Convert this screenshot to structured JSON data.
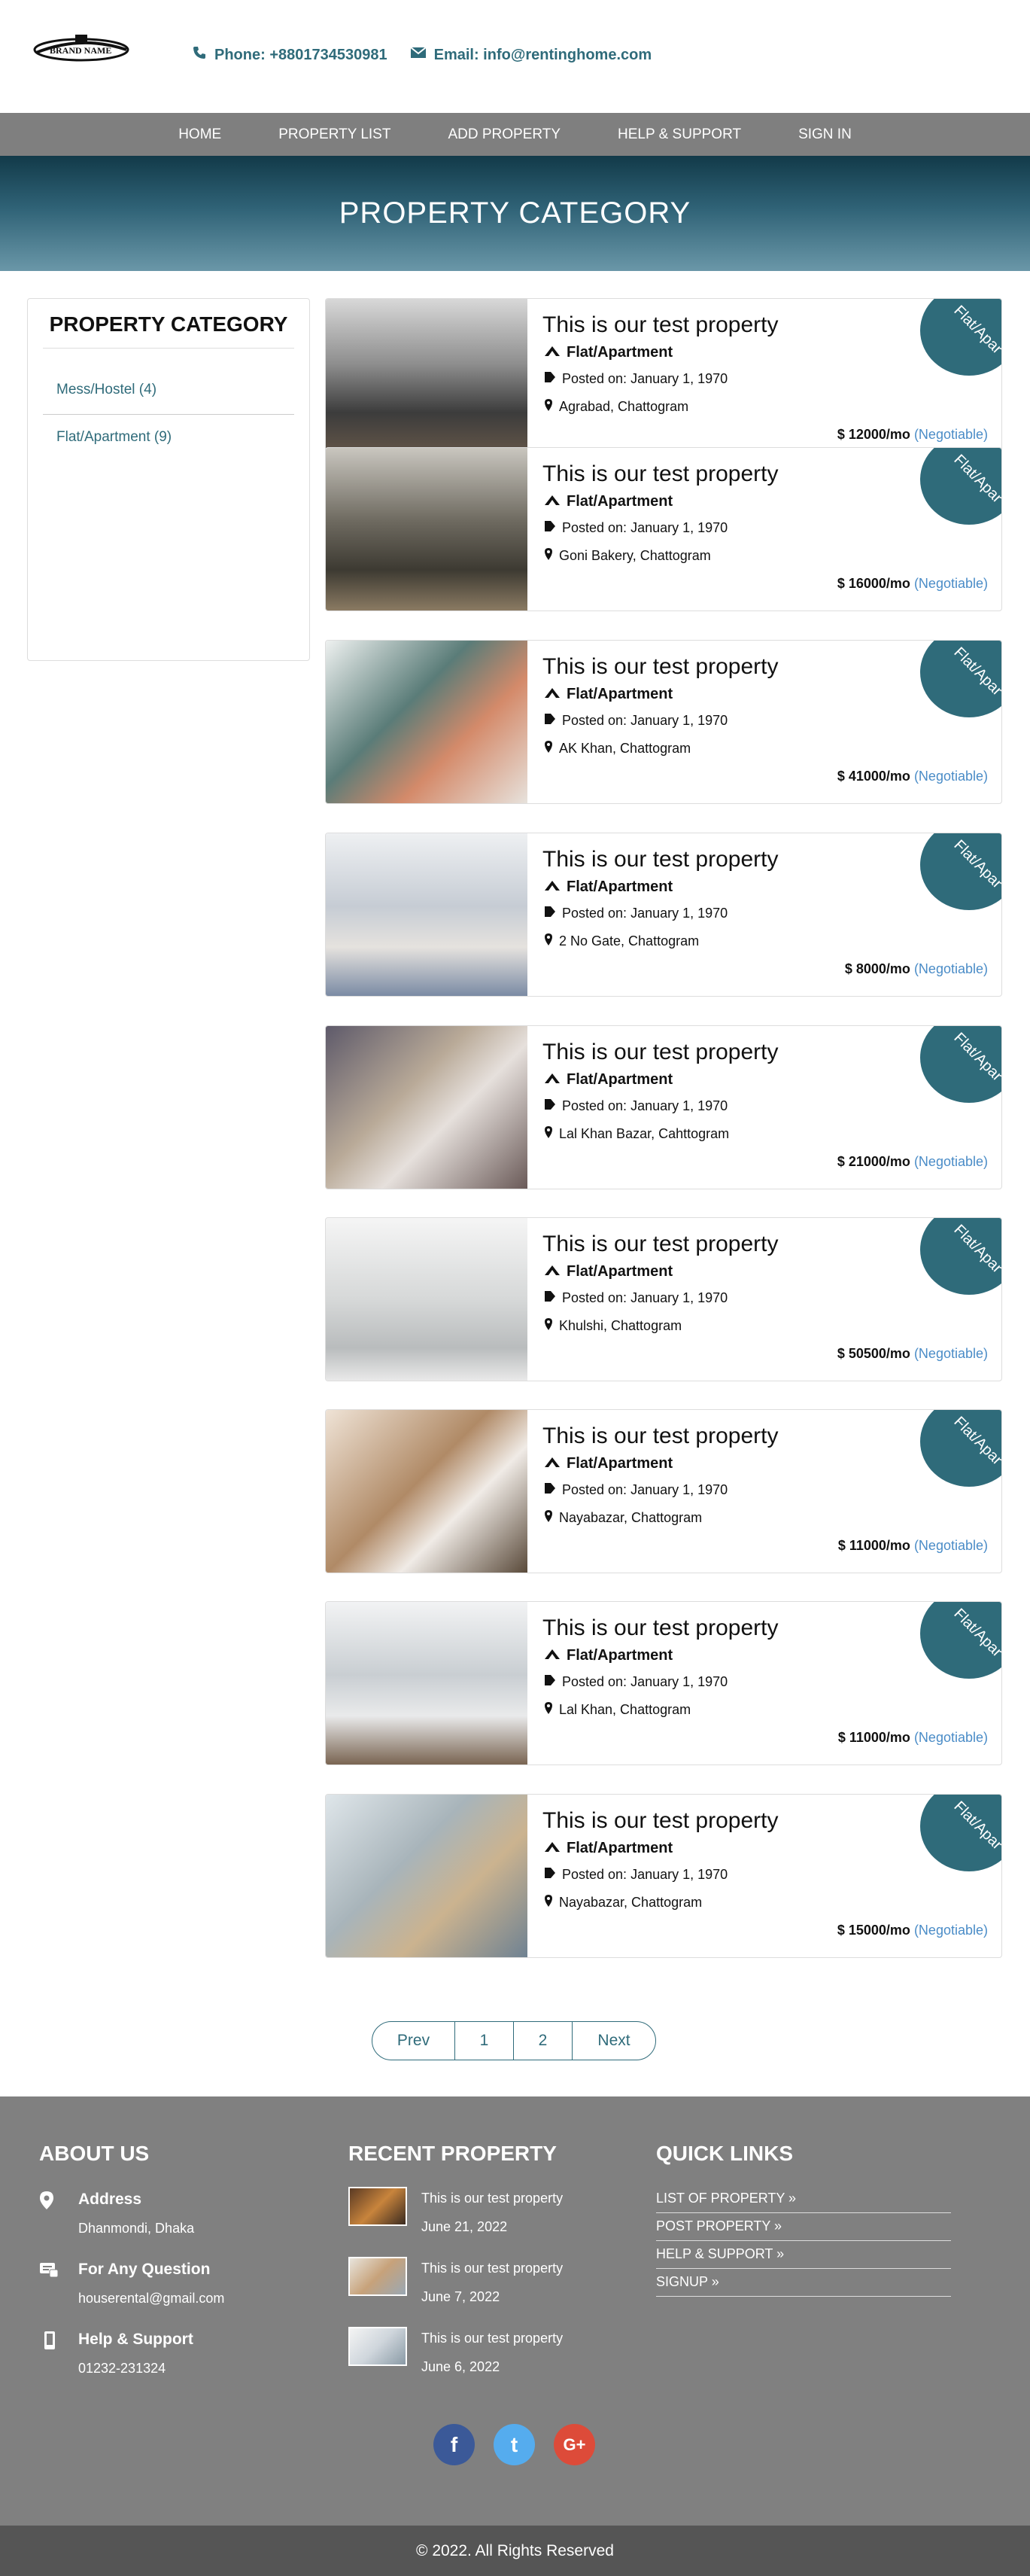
{
  "header": {
    "logo_text": "BRAND NAME",
    "phone": "Phone: +8801734530981",
    "email": "Email: info@rentinghome.com"
  },
  "nav": {
    "items": [
      {
        "label": "HOME"
      },
      {
        "label": "PROPERTY LIST"
      },
      {
        "label": "ADD PROPERTY"
      },
      {
        "label": "HELP & SUPPORT"
      },
      {
        "label": "SIGN IN"
      }
    ]
  },
  "hero": {
    "title": "PROPERTY CATEGORY"
  },
  "sidebar": {
    "title": "PROPERTY CATEGORY",
    "categories": [
      {
        "label": "Mess/Hostel (4)"
      },
      {
        "label": "Flat/Apartment (9)"
      }
    ]
  },
  "listings": [
    {
      "title": "This is our test property",
      "type": "Flat/Apartment",
      "posted": "Posted on: January 1, 1970",
      "location": "Agrabad, Chattogram",
      "price": "$ 12000/mo",
      "negotiable": "(Negotiable)",
      "ribbon": "Flat/Apar"
    },
    {
      "title": "This is our test property",
      "type": "Flat/Apartment",
      "posted": "Posted on: January 1, 1970",
      "location": "Goni Bakery, Chattogram",
      "price": "$ 16000/mo",
      "negotiable": "(Negotiable)",
      "ribbon": "Flat/Apar"
    },
    {
      "title": "This is our test property",
      "type": "Flat/Apartment",
      "posted": "Posted on: January 1, 1970",
      "location": "AK Khan, Chattogram",
      "price": "$ 41000/mo",
      "negotiable": "(Negotiable)",
      "ribbon": "Flat/Apar"
    },
    {
      "title": "This is our test property",
      "type": "Flat/Apartment",
      "posted": "Posted on: January 1, 1970",
      "location": "2 No Gate, Chattogram",
      "price": "$ 8000/mo",
      "negotiable": "(Negotiable)",
      "ribbon": "Flat/Apar"
    },
    {
      "title": "This is our test property",
      "type": "Flat/Apartment",
      "posted": "Posted on: January 1, 1970",
      "location": "Lal Khan Bazar, Cahttogram",
      "price": "$ 21000/mo",
      "negotiable": "(Negotiable)",
      "ribbon": "Flat/Apar"
    },
    {
      "title": "This is our test property",
      "type": "Flat/Apartment",
      "posted": "Posted on: January 1, 1970",
      "location": "Khulshi, Chattogram",
      "price": "$ 50500/mo",
      "negotiable": "(Negotiable)",
      "ribbon": "Flat/Apar"
    },
    {
      "title": "This is our test property",
      "type": "Flat/Apartment",
      "posted": "Posted on: January 1, 1970",
      "location": "Nayabazar, Chattogram",
      "price": "$ 11000/mo",
      "negotiable": "(Negotiable)",
      "ribbon": "Flat/Apar"
    },
    {
      "title": "This is our test property",
      "type": "Flat/Apartment",
      "posted": "Posted on: January 1, 1970",
      "location": "Lal Khan, Chattogram",
      "price": "$ 11000/mo",
      "negotiable": "(Negotiable)",
      "ribbon": "Flat/Apar"
    },
    {
      "title": "This is our test property",
      "type": "Flat/Apartment",
      "posted": "Posted on: January 1, 1970",
      "location": "Nayabazar, Chattogram",
      "price": "$ 15000/mo",
      "negotiable": "(Negotiable)",
      "ribbon": "Flat/Apar"
    }
  ],
  "pagination": {
    "prev": "Prev",
    "pages": [
      "1",
      "2"
    ],
    "next": "Next"
  },
  "footer": {
    "about": {
      "title": "ABOUT US",
      "address_title": "Address",
      "address": "Dhanmondi, Dhaka",
      "question_title": "For Any Question",
      "question": "houserental@gmail.com",
      "support_title": "Help & Support",
      "support": "01232-231324"
    },
    "recent": {
      "title": "RECENT PROPERTY",
      "items": [
        {
          "title": "This is our test property",
          "date": "June 21, 2022"
        },
        {
          "title": "This is our test property",
          "date": "June 7, 2022"
        },
        {
          "title": "This is our test property",
          "date": "June 6, 2022"
        }
      ]
    },
    "quick": {
      "title": "QUICK LINKS",
      "links": [
        {
          "label": "LIST OF PROPERTY »"
        },
        {
          "label": "POST PROPERTY »"
        },
        {
          "label": "HELP & SUPPORT »"
        },
        {
          "label": "SIGNUP »"
        }
      ]
    },
    "social": [
      {
        "icon": "facebook-icon",
        "glyph": "f",
        "color": "#3b5998"
      },
      {
        "icon": "twitter-icon",
        "glyph": "t",
        "color": "#55acee"
      },
      {
        "icon": "google-plus-icon",
        "glyph": "G+",
        "color": "#dd4b39"
      }
    ],
    "copyright": "© 2022. All Rights Reserved"
  },
  "colors": {
    "accent": "#2f6b7a",
    "nav": "#7f7f7f",
    "footer": "#808080",
    "copyright": "#555555",
    "link": "#4a8cc7"
  }
}
